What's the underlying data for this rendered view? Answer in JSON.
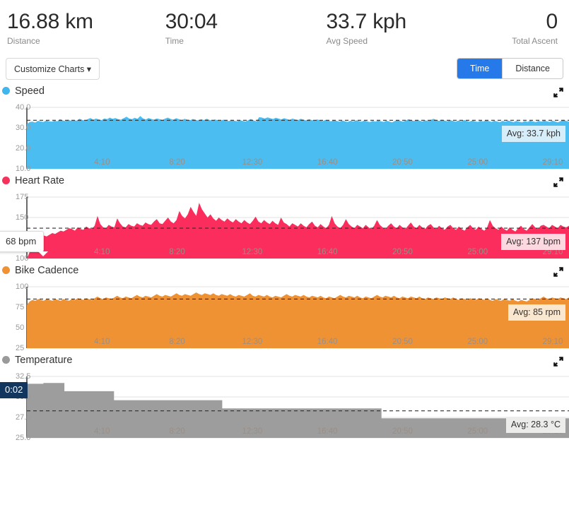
{
  "summary": {
    "metrics": [
      {
        "value": "16.88 km",
        "label": "Distance"
      },
      {
        "value": "30:04",
        "label": "Time"
      },
      {
        "value": "33.7 kph",
        "label": "Avg Speed"
      },
      {
        "value": "0",
        "label": "Total Ascent"
      }
    ]
  },
  "controls": {
    "customize_label": "Customize Charts ▾",
    "axis_toggle": {
      "options": [
        "Time",
        "Distance"
      ],
      "selected": "Time",
      "active_color": "#2579e8"
    }
  },
  "charts": [
    {
      "name": "speed",
      "title": "Speed",
      "color": "#3fb6ee",
      "fill": "#4cbdf0",
      "badge_bg": "#d6edfa",
      "avg_label": "Avg: 33.7 kph",
      "y_ticks": [
        "40.0",
        "30.0",
        "20.0",
        "10.0"
      ],
      "x_ticks": [
        "4:10",
        "8:20",
        "12:30",
        "16:40",
        "20:50",
        "25:00",
        "29:10"
      ]
    },
    {
      "name": "heart-rate",
      "title": "Heart Rate",
      "color": "#f5325b",
      "fill": "#fa2d5c",
      "badge_bg": "#fcd9e1",
      "avg_label": "Avg: 137 bpm",
      "y_ticks": [
        "175",
        "150",
        "125",
        "100"
      ],
      "x_ticks": [
        "4:10",
        "8:20",
        "12:30",
        "16:40",
        "20:50",
        "25:00",
        "29:10"
      ],
      "hover_tip": "68 bpm"
    },
    {
      "name": "bike-cadence",
      "title": "Bike Cadence",
      "color": "#f09133",
      "fill": "#ef9234",
      "badge_bg": "#fae7cf",
      "avg_label": "Avg: 85 rpm",
      "y_ticks": [
        "100",
        "75",
        "50",
        "25"
      ],
      "x_ticks": [
        "4:10",
        "8:20",
        "12:30",
        "16:40",
        "20:50",
        "25:00",
        "29:10"
      ]
    },
    {
      "name": "temperature",
      "title": "Temperature",
      "color": "#9a9a9a",
      "fill": "#9d9d9d",
      "badge_bg": "#ececea",
      "avg_label": "Avg: 28.3 °C",
      "y_ticks": [
        "32.5",
        "30.0",
        "27.5",
        "25.0"
      ],
      "x_ticks": [
        "4:10",
        "8:20",
        "12:30",
        "16:40",
        "20:50",
        "25:00",
        "29:10"
      ],
      "time_badge": "0:02"
    }
  ],
  "chart_data": [
    {
      "type": "area",
      "name": "Speed",
      "title": "Speed",
      "xlabel": "Time",
      "ylabel": "kph",
      "ylim": [
        10.0,
        40.0
      ],
      "xlim": [
        0,
        1804
      ],
      "grid": true,
      "average": 33.7,
      "average_label": "Avg: 33.7 kph",
      "xtick_labels": [
        "4:10",
        "8:20",
        "12:30",
        "16:40",
        "20:50",
        "25:00",
        "29:10"
      ],
      "xtick_seconds": [
        250,
        500,
        750,
        1000,
        1250,
        1500,
        1750
      ],
      "ytick_labels": [
        "40.0",
        "30.0",
        "20.0",
        "10.0"
      ],
      "ytick_values": [
        40.0,
        30.0,
        20.0,
        10.0
      ],
      "values": [
        31.8,
        32.8,
        33.0,
        32.6,
        33.4,
        33.1,
        32.9,
        33.6,
        33.2,
        33.0,
        33.5,
        33.2,
        34.2,
        33.6,
        33.3,
        34.0,
        33.4,
        33.8,
        33.5,
        34.4,
        33.9,
        33.5,
        34.2,
        34.8,
        34.0,
        34.5,
        34.1,
        33.8,
        34.6,
        34.2,
        35.0,
        34.4,
        34.8,
        34.2,
        34.0,
        34.7,
        35.4,
        34.6,
        34.2,
        34.9,
        34.4,
        35.8,
        34.6,
        34.1,
        34.8,
        34.3,
        34.0,
        34.6,
        34.2,
        33.9,
        34.5,
        35.0,
        34.3,
        34.0,
        34.7,
        34.2,
        33.8,
        34.4,
        34.0,
        33.7,
        34.3,
        33.9,
        33.6,
        34.2,
        33.8,
        34.4,
        33.9,
        33.5,
        34.1,
        33.7,
        33.4,
        34.0,
        33.6,
        33.3,
        33.9,
        33.5,
        33.2,
        33.8,
        33.4,
        33.1,
        33.7,
        34.3,
        33.6,
        33.2,
        35.2,
        35.0,
        34.6,
        35.1,
        34.7,
        34.3,
        34.9,
        34.5,
        34.1,
        34.7,
        34.3,
        33.9,
        34.5,
        34.1,
        33.8,
        34.4,
        34.0,
        33.6,
        34.2,
        33.8,
        33.5,
        34.1,
        33.7,
        33.3,
        33.9,
        33.5,
        33.2,
        33.8,
        33.4,
        33.0,
        33.6,
        33.2,
        32.9,
        33.5,
        33.1,
        33.7,
        33.3,
        33.0,
        33.6,
        33.2,
        32.8,
        33.4,
        33.0,
        33.6,
        33.2,
        32.9,
        33.5,
        33.1,
        32.7,
        33.3,
        33.9,
        33.4,
        33.0,
        33.6,
        34.2,
        33.7,
        33.3,
        33.9,
        33.5,
        33.1,
        33.7,
        33.3,
        33.9,
        34.4,
        33.8,
        33.4,
        34.0,
        33.6,
        33.2,
        33.8,
        33.4,
        33.0,
        33.6,
        33.2,
        33.8,
        33.4,
        33.0,
        33.6,
        33.2,
        32.9,
        33.5,
        33.1,
        33.7,
        33.3,
        32.9,
        33.5,
        33.1,
        32.8,
        33.4,
        33.0,
        33.6,
        33.2,
        32.8,
        33.4,
        33.0,
        32.7,
        33.3,
        32.9,
        33.5,
        33.1,
        32.8,
        33.4,
        33.0,
        33.6,
        33.2,
        32.9,
        33.5,
        33.1,
        32.7,
        33.3,
        33.9,
        33.4,
        33.0
      ]
    },
    {
      "type": "area",
      "name": "Heart Rate",
      "title": "Heart Rate",
      "xlabel": "Time",
      "ylabel": "bpm",
      "ylim": [
        100,
        175
      ],
      "xlim": [
        0,
        1804
      ],
      "grid": true,
      "average": 137,
      "average_label": "Avg: 137 bpm",
      "hover_value": "68 bpm",
      "xtick_labels": [
        "4:10",
        "8:20",
        "12:30",
        "16:40",
        "20:50",
        "25:00",
        "29:10"
      ],
      "xtick_seconds": [
        250,
        500,
        750,
        1000,
        1250,
        1500,
        1750
      ],
      "ytick_labels": [
        "175",
        "150",
        "125",
        "100"
      ],
      "ytick_values": [
        175,
        150,
        125,
        100
      ],
      "values": [
        100,
        108,
        118,
        122,
        124,
        126,
        128,
        127,
        129,
        131,
        130,
        132,
        134,
        133,
        135,
        137,
        136,
        134,
        138,
        136,
        135,
        139,
        137,
        136,
        140,
        152,
        142,
        138,
        137,
        141,
        139,
        138,
        149,
        143,
        139,
        138,
        142,
        140,
        139,
        143,
        141,
        140,
        144,
        142,
        141,
        145,
        148,
        143,
        142,
        146,
        150,
        145,
        143,
        147,
        158,
        152,
        149,
        154,
        163,
        157,
        152,
        168,
        160,
        155,
        150,
        154,
        149,
        146,
        150,
        147,
        145,
        149,
        146,
        144,
        148,
        145,
        143,
        147,
        144,
        142,
        146,
        151,
        145,
        143,
        147,
        144,
        142,
        146,
        143,
        141,
        150,
        144,
        142,
        139,
        143,
        141,
        139,
        143,
        140,
        138,
        142,
        145,
        140,
        138,
        142,
        139,
        137,
        141,
        152,
        143,
        139,
        137,
        141,
        148,
        142,
        139,
        137,
        141,
        139,
        137,
        141,
        138,
        136,
        140,
        147,
        141,
        138,
        136,
        140,
        143,
        139,
        137,
        141,
        138,
        136,
        140,
        144,
        139,
        137,
        141,
        138,
        136,
        140,
        142,
        138,
        136,
        140,
        137,
        135,
        139,
        141,
        137,
        135,
        139,
        136,
        134,
        138,
        141,
        137,
        135,
        139,
        136,
        134,
        138,
        147,
        140,
        137,
        135,
        139,
        136,
        134,
        138,
        135,
        133,
        137,
        140,
        136,
        134,
        138,
        142,
        138,
        136,
        140,
        141,
        139,
        137,
        141,
        139,
        137,
        141,
        139,
        138,
        140
      ]
    },
    {
      "type": "area",
      "name": "Bike Cadence",
      "title": "Bike Cadence",
      "xlabel": "Time",
      "ylabel": "rpm",
      "ylim": [
        25,
        100
      ],
      "xlim": [
        0,
        1804
      ],
      "grid": true,
      "average": 85,
      "average_label": "Avg: 85 rpm",
      "xtick_labels": [
        "4:10",
        "8:20",
        "12:30",
        "16:40",
        "20:50",
        "25:00",
        "29:10"
      ],
      "xtick_seconds": [
        250,
        500,
        750,
        1000,
        1250,
        1500,
        1750
      ],
      "ytick_labels": [
        "100",
        "75",
        "50",
        "25"
      ],
      "ytick_values": [
        100,
        75,
        50,
        25
      ],
      "values": [
        78,
        82,
        84,
        83,
        85,
        84,
        83,
        85,
        84,
        83,
        85,
        84,
        83,
        85,
        84,
        83,
        85,
        84,
        86,
        85,
        84,
        86,
        85,
        84,
        86,
        88,
        86,
        85,
        87,
        86,
        85,
        87,
        89,
        87,
        86,
        88,
        87,
        86,
        88,
        90,
        88,
        87,
        89,
        88,
        87,
        89,
        91,
        89,
        88,
        90,
        89,
        88,
        90,
        92,
        90,
        89,
        91,
        90,
        89,
        91,
        93,
        91,
        90,
        92,
        91,
        90,
        92,
        90,
        89,
        91,
        90,
        89,
        91,
        89,
        88,
        90,
        89,
        88,
        90,
        92,
        89,
        88,
        90,
        89,
        88,
        90,
        88,
        87,
        89,
        88,
        87,
        89,
        91,
        89,
        88,
        90,
        89,
        88,
        90,
        88,
        87,
        89,
        88,
        87,
        89,
        87,
        86,
        88,
        87,
        86,
        88,
        90,
        88,
        87,
        89,
        88,
        87,
        89,
        87,
        86,
        88,
        87,
        86,
        88,
        90,
        88,
        87,
        89,
        88,
        87,
        89,
        87,
        86,
        88,
        87,
        86,
        88,
        87,
        86,
        88,
        86,
        85,
        87,
        86,
        85,
        87,
        86,
        85,
        87,
        86,
        85,
        87,
        85,
        84,
        86,
        85,
        84,
        86,
        85,
        84,
        86,
        85,
        84,
        86,
        84,
        83,
        85,
        84,
        83,
        85,
        84,
        83,
        85,
        83,
        82,
        84,
        83,
        82,
        84,
        86,
        85,
        84,
        86,
        88,
        86,
        85,
        87,
        86,
        85,
        87,
        86,
        85,
        87
      ]
    },
    {
      "type": "area",
      "name": "Temperature",
      "title": "Temperature",
      "xlabel": "Time",
      "ylabel": "°C",
      "ylim": [
        25.0,
        32.5
      ],
      "xlim": [
        0,
        1804
      ],
      "grid": true,
      "average": 28.3,
      "average_label": "Avg: 28.3 °C",
      "time_badge": "0:02",
      "step": true,
      "xtick_labels": [
        "4:10",
        "8:20",
        "12:30",
        "16:40",
        "20:50",
        "25:00",
        "29:10"
      ],
      "xtick_seconds": [
        250,
        500,
        750,
        1000,
        1250,
        1500,
        1750
      ],
      "ytick_labels": [
        "32.5",
        "30.0",
        "27.5",
        "25.0"
      ],
      "ytick_values": [
        32.5,
        30.0,
        27.5,
        25.0
      ],
      "step_points": [
        {
          "t": 0,
          "v": 31.6
        },
        {
          "t": 55,
          "v": 31.7
        },
        {
          "t": 125,
          "v": 30.7
        },
        {
          "t": 290,
          "v": 29.6
        },
        {
          "t": 650,
          "v": 28.6
        },
        {
          "t": 1180,
          "v": 27.4
        },
        {
          "t": 1804,
          "v": 27.4
        }
      ]
    }
  ]
}
